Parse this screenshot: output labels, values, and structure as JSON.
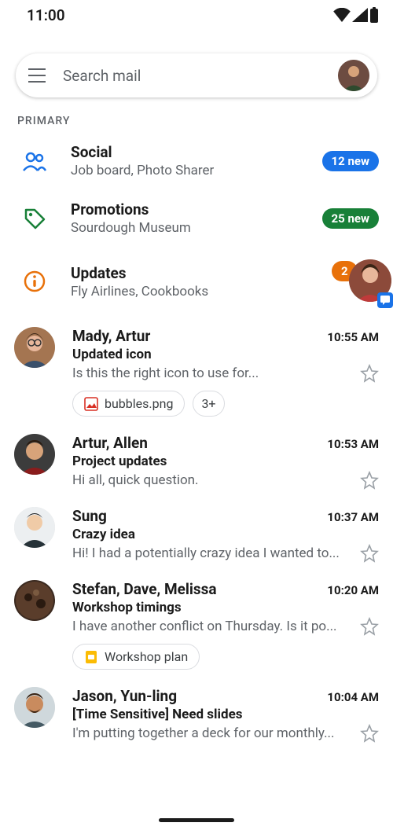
{
  "status": {
    "time": "11:00"
  },
  "search": {
    "placeholder": "Search mail"
  },
  "section": "PRIMARY",
  "categories": [
    {
      "title": "Social",
      "sub": "Job board, Photo Sharer",
      "badge": "12 new",
      "badge_color": "blue",
      "icon": "people-icon"
    },
    {
      "title": "Promotions",
      "sub": "Sourdough Museum",
      "badge": "25 new",
      "badge_color": "green",
      "icon": "tag-icon"
    },
    {
      "title": "Updates",
      "sub": "Fly Airlines, Cookbooks",
      "badge": "2",
      "badge_color": "orange",
      "icon": "info-icon"
    }
  ],
  "emails": [
    {
      "sender": "Mady, Artur",
      "time": "10:55 AM",
      "subject": "Updated icon",
      "snippet": "Is this the right icon to use for...",
      "attachments": [
        {
          "label": "bubbles.png",
          "kind": "image"
        },
        {
          "label": "3+",
          "kind": "count"
        }
      ]
    },
    {
      "sender": "Artur, Allen",
      "time": "10:53 AM",
      "subject": "Project updates",
      "snippet": "Hi all, quick question."
    },
    {
      "sender": "Sung",
      "time": "10:37 AM",
      "subject": "Crazy idea",
      "snippet": "Hi! I had a potentially crazy idea I wanted to..."
    },
    {
      "sender": "Stefan, Dave, Melissa",
      "time": "10:20 AM",
      "subject": "Workshop timings",
      "snippet": "I have another conflict on Thursday. Is it po...",
      "attachments": [
        {
          "label": "Workshop plan",
          "kind": "slides"
        }
      ]
    },
    {
      "sender": "Jason, Yun-ling",
      "time": "10:04 AM",
      "subject": "[Time Sensitive] Need slides",
      "snippet": "I'm putting together a deck for our monthly..."
    }
  ]
}
